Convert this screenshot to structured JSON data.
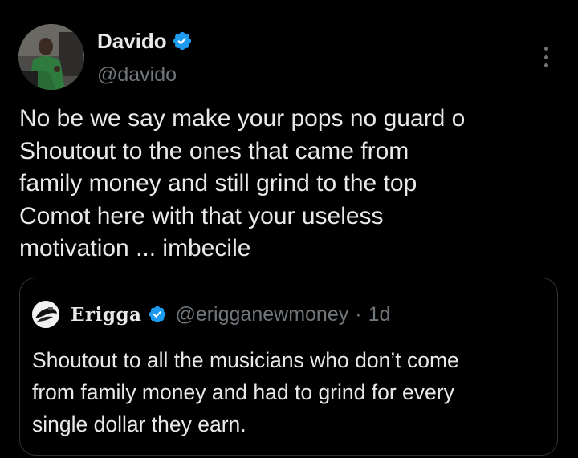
{
  "author": {
    "name": "Davido",
    "handle": "@davido",
    "verified_icon": "verified-badge-icon",
    "avatar_icon": "profile-photo"
  },
  "more_icon": "more-options-icon",
  "tweet": {
    "lines": [
      "No be we say make your pops no guard o",
      "Shoutout to the ones that came from",
      "family money and still grind to the top",
      "Comot here with that your useless",
      "motivation ... imbecile"
    ]
  },
  "quote": {
    "name": "Erigga",
    "handle": "@erigganewmoney",
    "separator": "·",
    "time": "1d",
    "lines": [
      "Shoutout to all the musicians who don’t come",
      "from family money and had to grind for every",
      "single dollar they earn."
    ]
  },
  "colors": {
    "background": "#000000",
    "text": "#e7e9ea",
    "muted": "#71767b",
    "verified": "#1d9bf0",
    "border": "#2f3336"
  }
}
